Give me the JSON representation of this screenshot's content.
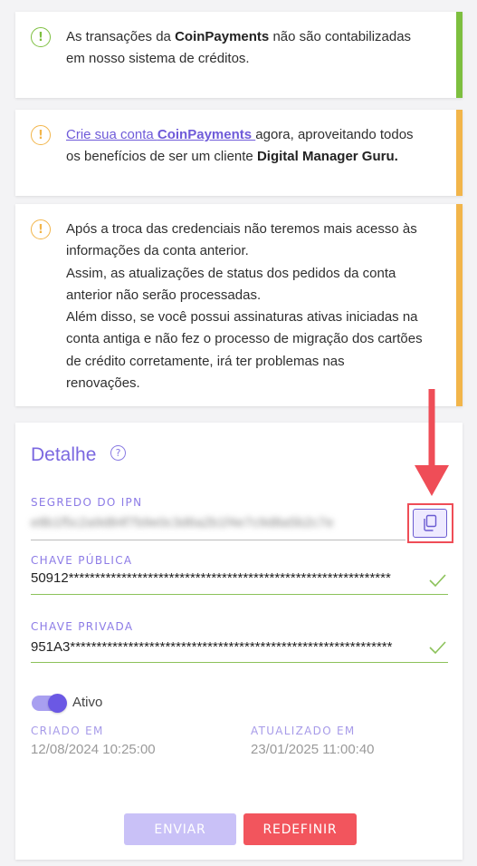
{
  "alerts": [
    {
      "color": "#7dbf3f",
      "icon": "info-circle-icon",
      "lines": [
        [
          "As transações da ",
          "CoinPayments",
          " não são contabilizadas"
        ],
        [
          "em nosso sistema de créditos."
        ]
      ]
    },
    {
      "color": "#f2b54a",
      "icon": "warning-circle-icon",
      "link_text": "Crie sua conta ",
      "link_bold": "CoinPayments ",
      "after_link": "agora, aproveitando todos",
      "line2_pre": "os benefícios de ser um cliente ",
      "line2_bold": "Digital Manager Guru."
    },
    {
      "color": "#f2b54a",
      "icon": "warning-circle-icon",
      "lines": [
        "Após a troca das credenciais não teremos mais acesso às",
        "informações da conta anterior.",
        "Assim, as atualizações de status dos pedidos da conta",
        "anterior não serão processadas.",
        "Além disso, se você possui assinaturas ativas iniciadas na",
        "conta antiga e não fez o processo de migração dos cartões",
        "de crédito corretamente, irá ter problemas nas",
        "renovações."
      ]
    }
  ],
  "detail": {
    "title": "Detalhe",
    "help_icon": "?",
    "ipn_label": "SEGREDO DO IPN",
    "ipn_value": "e8b1f5c2a9d84f7b9e0c3d6a2b1f4e7c9d8a5b2c7e",
    "public_key_label": "CHAVE PÚBLICA",
    "public_key_value": "50912*************************************************************",
    "private_key_label": "CHAVE PRIVADA",
    "private_key_value": "951A3*************************************************************",
    "toggle_label": "Ativo",
    "toggle_on": true,
    "created_label": "CRIADO EM",
    "created_value": "12/08/2024 10:25:00",
    "updated_label": "ATUALIZADO EM",
    "updated_value": "23/01/2025 11:00:40",
    "send_label": "ENVIAR",
    "reset_label": "REDEFINIR"
  },
  "colors": {
    "accent": "#7b68e0",
    "success": "#7dbf3f",
    "warning": "#f2b54a",
    "danger": "#f2555d",
    "annotation": "#ef4d57"
  }
}
